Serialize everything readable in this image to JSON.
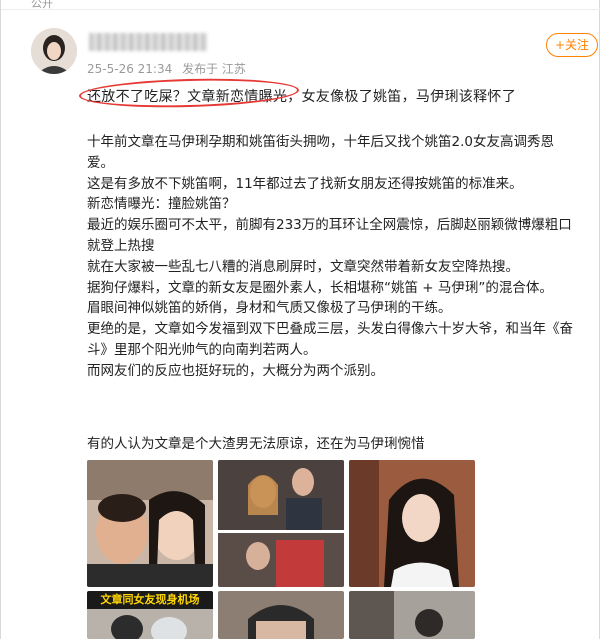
{
  "header": {
    "top_label": "公开"
  },
  "post": {
    "timestamp": "25-5-26 21:34",
    "location": "发布于 江苏",
    "follow_label": "+关注",
    "title": "还放不了吃屎？文章新恋情曝光，女友像极了姚笛，马伊琍该释怀了",
    "paragraphs": [
      "十年前文章在马伊琍孕期和姚笛街头拥吻，十年后又找个姚笛2.0女友高调秀恩",
      "爱。",
      "这是有多放不下姚笛啊，11年都过去了找新女朋友还得按姚笛的标准来。",
      "新恋情曝光：撞脸姚笛？",
      "最近的娱乐圈可不太平，前脚有233万的耳环让全网震惊，后脚赵丽颖微博爆粗口",
      "就登上热搜",
      "就在大家被一些乱七八糟的消息刷屏时，文章突然带着新女友空降热搜。",
      "据狗仔爆料，文章的新女友是圈外素人，长相堪称“姚笛 + 马伊琍”的混合体。",
      "眉眼间神似姚笛的娇俏，身材和气质又像极了马伊琍的干练。",
      "更绝的是，文章如今发福到双下巴叠成三层，头发白得像六十岁大爷，和当年《奋",
      "斗》里那个阳光帅气的向南判若两人。",
      "而网友们的反应也挺好玩的，大概分为两个派别。"
    ],
    "lead_line": "有的人认为文章是个大渣男无法原谅，还在为马伊琍惋惜",
    "photo_caption": "文章同女友现身机场"
  }
}
